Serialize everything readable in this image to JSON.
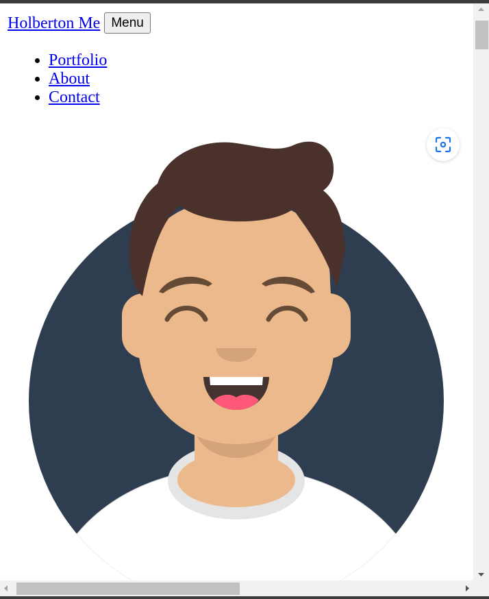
{
  "header": {
    "brand_label": "Holberton Me",
    "menu_label": "Menu"
  },
  "nav": {
    "items": [
      {
        "label": "Portfolio"
      },
      {
        "label": "About"
      },
      {
        "label": "Contact"
      }
    ]
  },
  "avatar": {
    "icon": "smiling-man-avatar",
    "colors": {
      "background_circle": "#2e3e50",
      "skin": "#ecb98c",
      "skin_shadow": "#d4a37a",
      "hair": "#4b312b",
      "eyebrows": "#654a36",
      "mouth": "#44332e",
      "tongue": "#fd5877",
      "shirt": "#ffffff",
      "collar": "#e5e5e5"
    }
  },
  "overlay": {
    "icon": "visual-search-icon",
    "accent": "#1a73e8"
  },
  "link_color": "#0000ee"
}
